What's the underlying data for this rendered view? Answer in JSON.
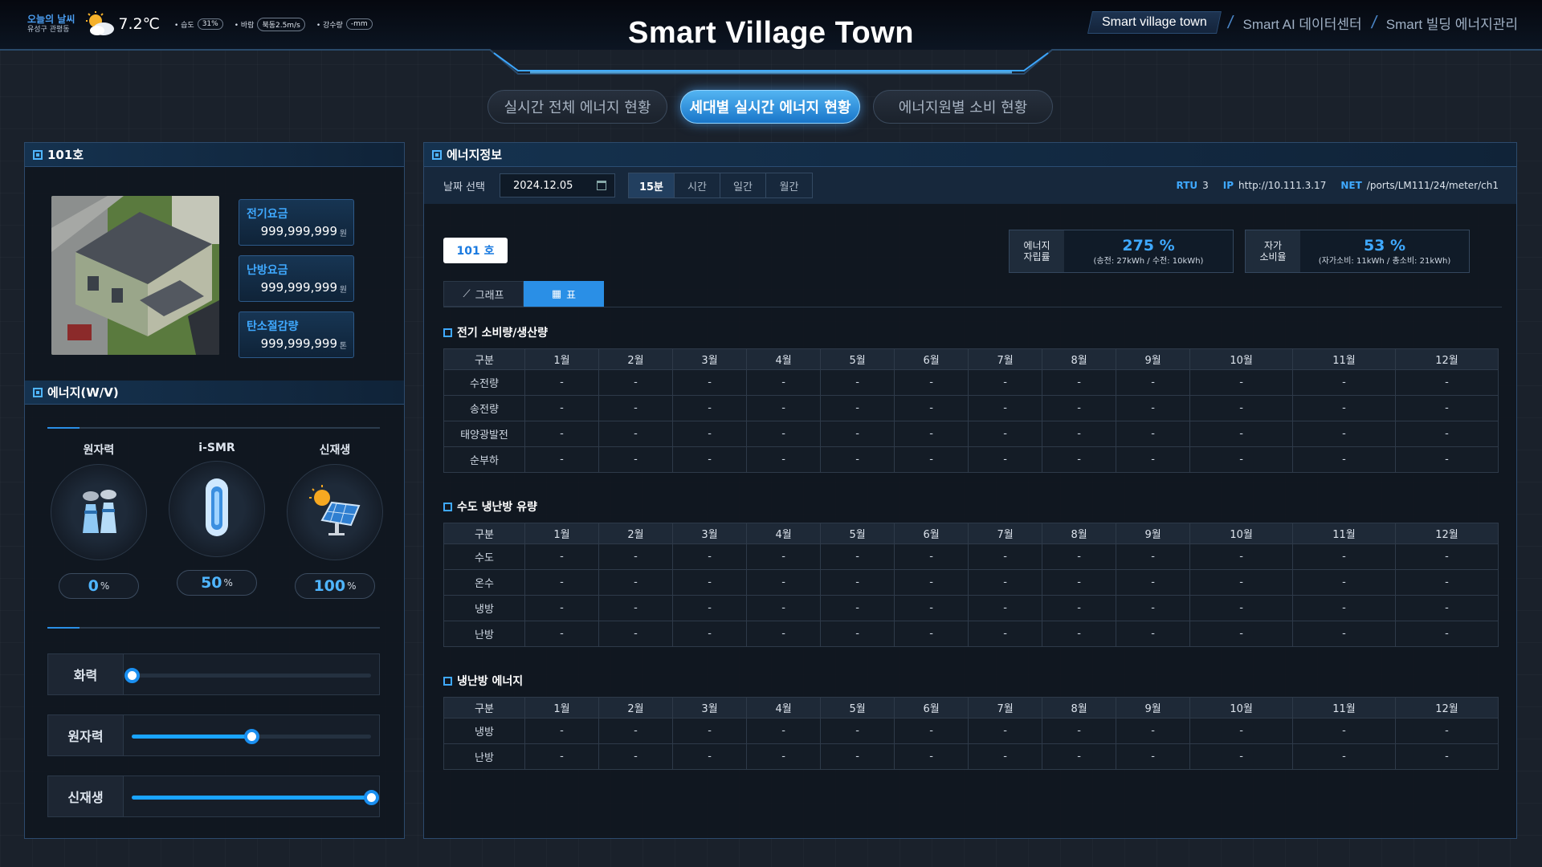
{
  "weather": {
    "label": "오늘의 날씨",
    "location": "유성구 관평동",
    "temperature": "7.2℃",
    "humidity_label": "• 습도",
    "humidity": "31%",
    "wind_label": "• 바람",
    "wind": "북동2.5m/s",
    "rain_label": "• 강수량",
    "rain": "-mm",
    "icon": "partly-cloudy-icon"
  },
  "header": {
    "title": "Smart Village Town",
    "nav": [
      "Smart village town",
      "Smart AI 데이터센터",
      "Smart 빌딩 에너지관리"
    ]
  },
  "tabs": [
    "실시간 전체 에너지 현황",
    "세대별 실시간 에너지 현황",
    "에너지원별 소비 현황"
  ],
  "left": {
    "unit_title": "101호",
    "fees": [
      {
        "label": "전기요금",
        "value": "999,999,999",
        "unit": "원"
      },
      {
        "label": "난방요금",
        "value": "999,999,999",
        "unit": "원"
      },
      {
        "label": "탄소절감량",
        "value": "999,999,999",
        "unit": "톤"
      }
    ],
    "energy_title": "에너지(W/V)",
    "sources": [
      {
        "label": "원자력",
        "pct": "0",
        "unit": "%"
      },
      {
        "label": "i-SMR",
        "pct": "50",
        "unit": "%"
      },
      {
        "label": "신재생",
        "pct": "100",
        "unit": "%"
      }
    ],
    "sliders": [
      {
        "label": "화력",
        "level": 0
      },
      {
        "label": "원자력",
        "level": 0.5
      },
      {
        "label": "신재생",
        "level": 1
      }
    ]
  },
  "right": {
    "title": "에너지정보",
    "date_label": "날짜 선택",
    "date": "2024.12.05",
    "periods": [
      "15분",
      "시간",
      "일간",
      "월간"
    ],
    "rtu_label": "RTU",
    "rtu": "3",
    "ip_label": "IP",
    "ip": "http://10.111.3.17",
    "net_label": "NET",
    "net": "/ports/LM111/24/meter/ch1",
    "unit_button": "101 호",
    "kpi1": {
      "label": "에너지\n자립률",
      "value": "275 %",
      "sub": "(송전: 27kWh / 수전: 10kWh)"
    },
    "kpi2": {
      "label": "자가\n소비율",
      "value": "53 %",
      "sub": "(자가소비: 11kWh / 총소비: 21kWh)"
    },
    "view_tabs": [
      "그래프",
      "표"
    ],
    "months": [
      "구분",
      "1월",
      "2월",
      "3월",
      "4월",
      "5월",
      "6월",
      "7월",
      "8월",
      "9월",
      "10월",
      "11월",
      "12월"
    ],
    "sections": [
      {
        "title": "전기 소비량/생산량",
        "rows": [
          "수전량",
          "송전량",
          "태양광발전",
          "순부하"
        ]
      },
      {
        "title": "수도 냉난방 유량",
        "rows": [
          "수도",
          "온수",
          "냉방",
          "난방"
        ]
      },
      {
        "title": "냉난방 에너지",
        "rows": [
          "냉방",
          "난방"
        ]
      }
    ],
    "empty_cell": "-"
  },
  "colors": {
    "accent": "#2a8fe6",
    "highlight": "#3fa9ff",
    "background": "#1a212b"
  }
}
